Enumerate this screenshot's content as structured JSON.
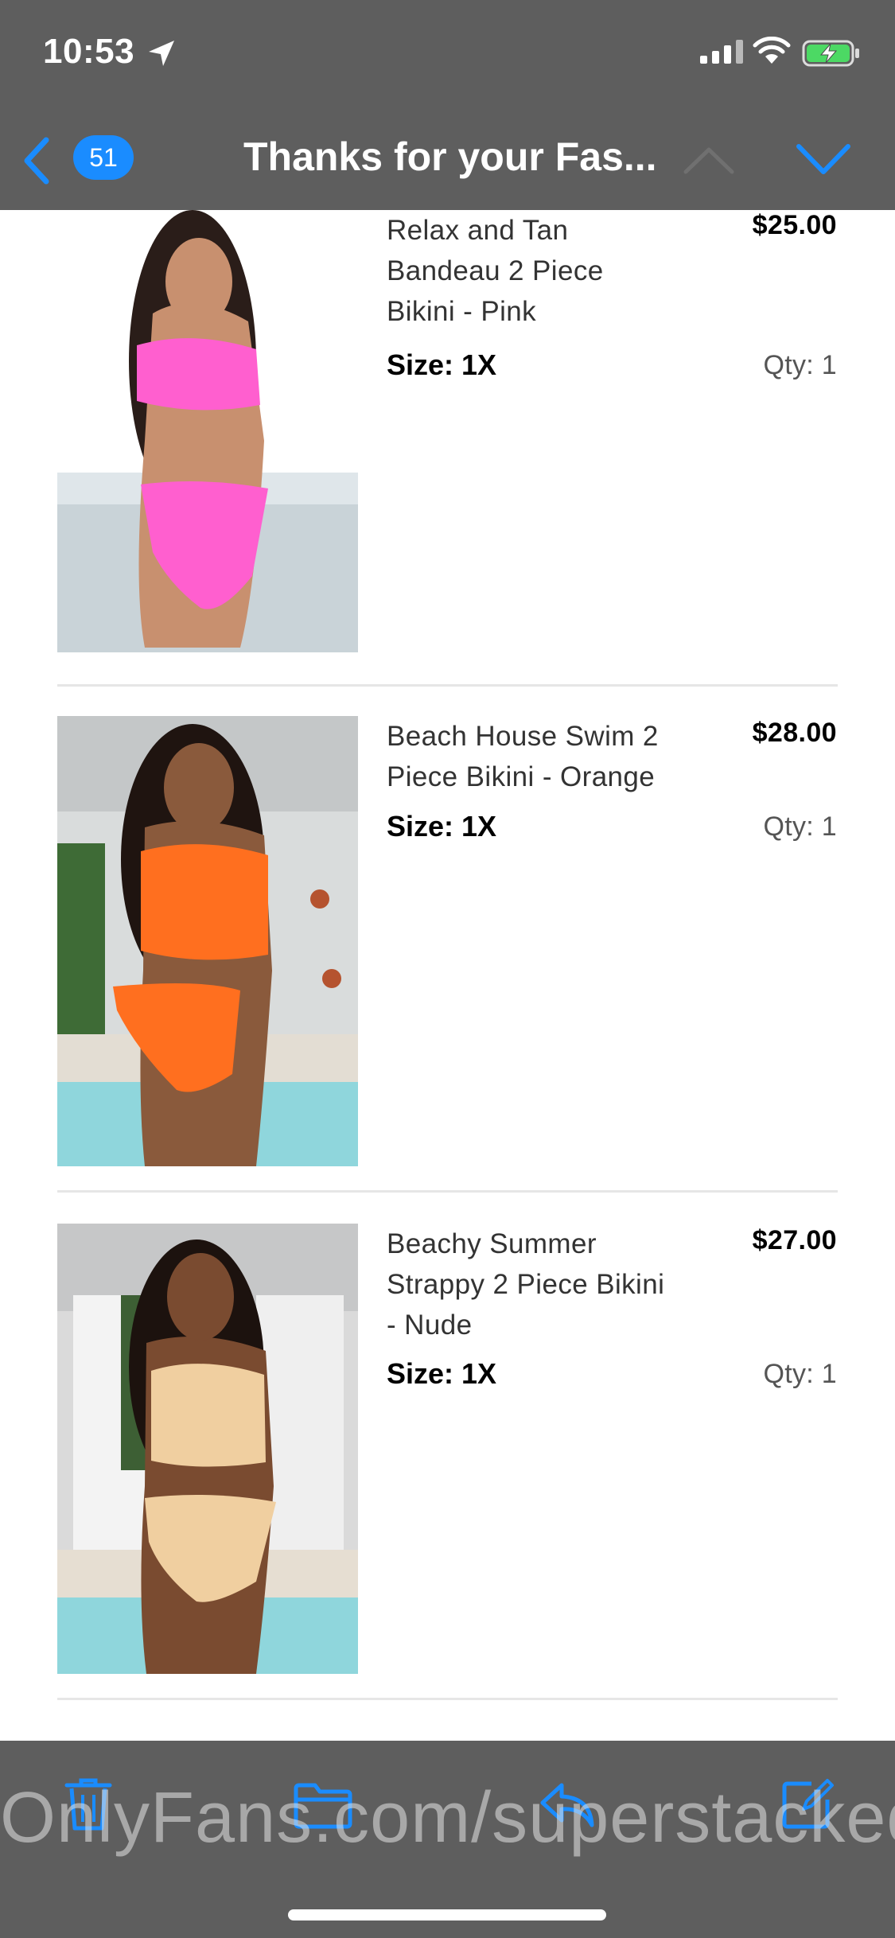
{
  "status_bar": {
    "time": "10:53"
  },
  "nav": {
    "unread_count": "51",
    "title": "Thanks for your Fas..."
  },
  "items": [
    {
      "name_lines": [
        "Relax and Tan",
        "Bandeau 2 Piece",
        "Bikini - Pink"
      ],
      "price": "$25.00",
      "size_label": "Size:",
      "size_value": "1X",
      "qty": "Qty: 1",
      "swim_color": "#ff5fcf"
    },
    {
      "name_lines": [
        "Beach House Swim 2",
        "Piece Bikini - Orange"
      ],
      "price": "$28.00",
      "size_label": "Size:",
      "size_value": "1X",
      "qty": "Qty: 1",
      "swim_color": "#ff6f1f"
    },
    {
      "name_lines": [
        "Beachy Summer",
        "Strappy 2 Piece Bikini",
        "- Nude"
      ],
      "price": "$27.00",
      "size_label": "Size:",
      "size_value": "1X",
      "qty": "Qty: 1",
      "swim_color": "#f0cfa0"
    }
  ],
  "watermark": "OnlyFans.com/superstacked",
  "colors": {
    "accent": "#1a8cff",
    "bar": "#5e5e5e"
  },
  "icons": [
    "location-arrow-icon",
    "signal-icon",
    "wifi-icon",
    "battery-charging-icon",
    "chevron-left-icon",
    "chevron-up-icon",
    "chevron-down-icon",
    "trash-icon",
    "folder-icon",
    "reply-icon",
    "compose-icon"
  ]
}
